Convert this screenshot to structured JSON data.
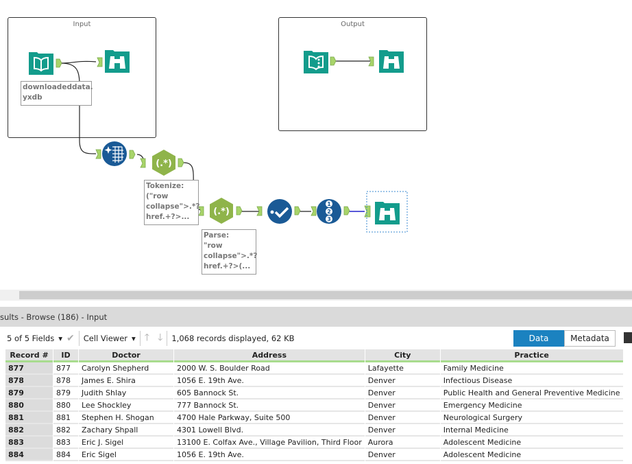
{
  "canvas": {
    "containers": [
      {
        "title": "Input"
      },
      {
        "title": "Output"
      }
    ],
    "annotations": {
      "input": "downloadeddata.\nyxdb",
      "tokenize": "Tokenize:\n(\"row\ncollapse\">.*?\nhref.+?>...",
      "parse": "Parse:\n\"row\ncollapse\">.*?\nhref.+?>(..."
    },
    "colors": {
      "teal": "#139c8c",
      "green": "#8fb44a",
      "blue": "#1a5a96",
      "connector": "#a8d46a"
    }
  },
  "results": {
    "title": "sults - Browse (186) - Input",
    "fields": "5 of 5 Fields",
    "viewer": "Cell Viewer",
    "status": "1,068 records displayed, 62 KB",
    "tabs": {
      "data": "Data",
      "metadata": "Metadata"
    },
    "columns": [
      "Record #",
      "ID",
      "Doctor",
      "Address",
      "City",
      "Practice"
    ],
    "rows": [
      [
        "877",
        "877",
        "Carolyn Shepherd",
        "2000 W. S. Boulder Road",
        "Lafayette",
        "Family Medicine"
      ],
      [
        "878",
        "878",
        "James E. Shira",
        "1056 E. 19th Ave.",
        "Denver",
        "Infectious Disease"
      ],
      [
        "879",
        "879",
        "Judith Shlay",
        "605 Bannock St.",
        "Denver",
        "Public Health and General Preventive Medicine"
      ],
      [
        "880",
        "880",
        "Lee Shockley",
        "777 Bannock St.",
        "Denver",
        "Emergency Medicine"
      ],
      [
        "881",
        "881",
        "Stephen H. Shogan",
        "4700 Hale Parkway, Suite 500",
        "Denver",
        "Neurological Surgery"
      ],
      [
        "882",
        "882",
        "Zachary Shpall",
        "4301 Lowell Blvd.",
        "Denver",
        "Internal Medicine"
      ],
      [
        "883",
        "883",
        "Eric J. Sigel",
        "13100 E. Colfax Ave., Village Pavilion, Third Floor",
        "Aurora",
        "Adolescent Medicine"
      ],
      [
        "884",
        "884",
        "Eric Sigel",
        "1056 E. 19th Ave.",
        "Denver",
        "Adolescent Medicine"
      ]
    ]
  }
}
